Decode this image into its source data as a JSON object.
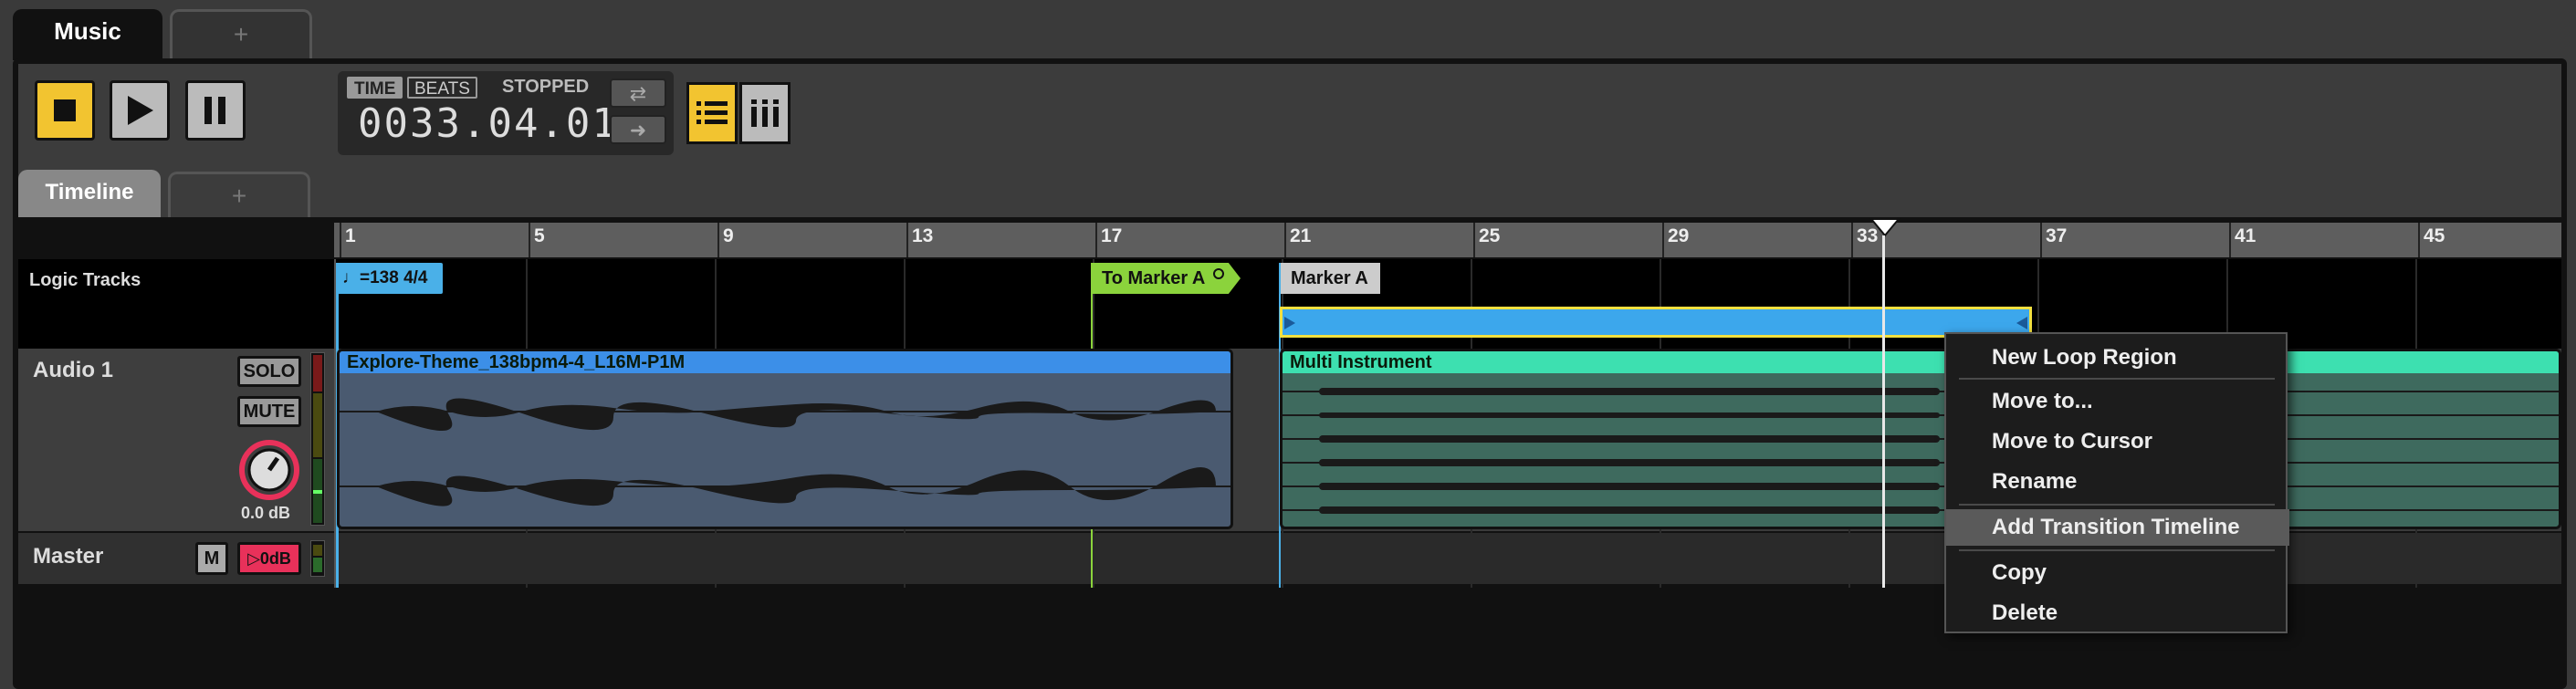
{
  "tabs": {
    "active": "Music",
    "add": "+"
  },
  "transport": {
    "time_badge": "TIME",
    "beats_badge": "BEATS",
    "status": "STOPPED",
    "time_value": "0033.04.01",
    "loop_icon": "⇄",
    "next_icon": "➜"
  },
  "subtabs": {
    "active": "Timeline",
    "add": "+"
  },
  "ruler": {
    "bars": [
      "1",
      "5",
      "9",
      "13",
      "17",
      "21",
      "25",
      "29",
      "33",
      "37",
      "41",
      "45"
    ]
  },
  "logic_tracks": {
    "label": "Logic Tracks",
    "tempo_marker": "♩=138 4/4",
    "transition_marker": "To Marker A",
    "marker": "Marker A"
  },
  "audio1": {
    "label": "Audio 1",
    "solo": "SOLO",
    "mute": "MUTE",
    "volume": "0.0 dB",
    "clip1": "Explore-Theme_138bpm4-4_L16M-P1M",
    "clip2": "Multi Instrument"
  },
  "master": {
    "label": "Master",
    "m": "M",
    "level": "▷0dB"
  },
  "context_menu": {
    "items": [
      "New Loop Region",
      "Move to...",
      "Move to Cursor",
      "Rename",
      "Add Transition Timeline",
      "Copy",
      "Delete"
    ]
  },
  "colors": {
    "accent": "#f2c430",
    "tempo": "#4ab0e8",
    "transition": "#8bd33c",
    "clip_blue": "#3c8fe8",
    "clip_teal": "#3de0b0",
    "loop_bar": "#3ca7ec"
  }
}
